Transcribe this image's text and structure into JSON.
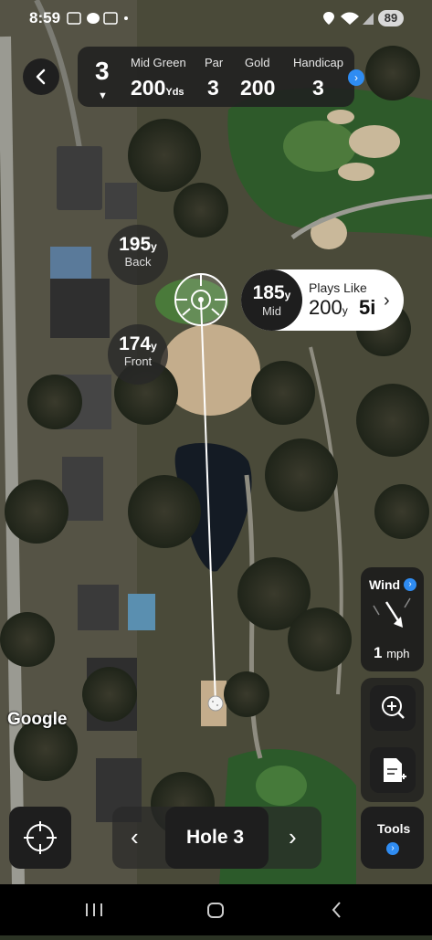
{
  "status_bar": {
    "time": "8:59",
    "battery": "89",
    "icons": [
      "screenshot-icon",
      "chat-bubble-icon",
      "calendar-icon",
      "dot-icon",
      "location-icon",
      "wifi-icon",
      "signal-icon"
    ]
  },
  "header": {
    "hole_number": "3",
    "caret": "▼",
    "target_label": "Mid Green",
    "target_distance": "200",
    "target_unit": "Yds",
    "par_label": "Par",
    "par_value": "3",
    "tee_label": "Gold",
    "tee_value": "200",
    "handicap_label": "Handicap",
    "handicap_value": "3"
  },
  "markers": {
    "back": {
      "distance": "195",
      "unit": "y",
      "label": "Back"
    },
    "front": {
      "distance": "174",
      "unit": "y",
      "label": "Front"
    },
    "mid": {
      "distance": "185",
      "unit": "y",
      "label": "Mid"
    }
  },
  "plays_like": {
    "label": "Plays Like",
    "distance": "200",
    "unit": "y",
    "club": "5i",
    "chevron": "›"
  },
  "wind": {
    "title": "Wind",
    "value": "1",
    "unit": "mph"
  },
  "tools": {
    "label": "Tools"
  },
  "hole_nav": {
    "prev": "‹",
    "label": "Hole 3",
    "next": "›"
  },
  "map": {
    "attribution": "Google"
  },
  "colors": {
    "accent_blue": "#2f8cf2",
    "panel_dark": "#1e1e1e",
    "green": "#3e6e2f"
  }
}
